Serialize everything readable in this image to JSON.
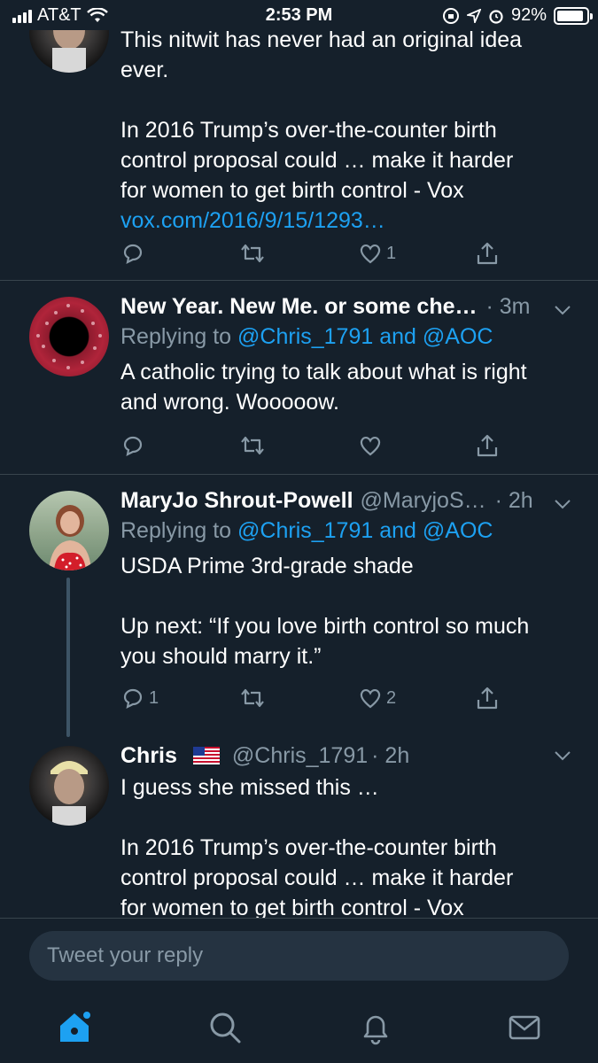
{
  "status_bar": {
    "carrier": "AT&T",
    "time": "2:53 PM",
    "battery": "92%",
    "battery_level": 0.92
  },
  "tweets": [
    {
      "body_lines": [
        "This nitwit has never had an original idea",
        "ever."
      ],
      "body2_lines": [
        "In 2016 Trump’s over-the-counter birth",
        "control proposal could … make it harder",
        "for women to get birth control - Vox"
      ],
      "link": "vox.com/2016/9/15/1293…",
      "counts": {
        "reply": "",
        "retweet": "",
        "like": "1"
      }
    },
    {
      "name": "New Year. New Me. or some che…",
      "time": "· 3m",
      "replying_prefix": "Replying to ",
      "replying_user1": "@Chris_1791",
      "replying_and": " and ",
      "replying_user2": "@AOC",
      "body_lines": [
        "A catholic trying to talk about what is right",
        "and wrong. Wooooow."
      ],
      "counts": {
        "reply": "",
        "retweet": "",
        "like": ""
      }
    },
    {
      "name": "MaryJo Shrout-Powell",
      "handle": "@MaryjoS…",
      "time": "· 2h",
      "replying_prefix": "Replying to ",
      "replying_user1": "@Chris_1791",
      "replying_and": " and ",
      "replying_user2": "@AOC",
      "body_lines": [
        "USDA Prime 3rd-grade shade"
      ],
      "body2_lines": [
        "Up next: “If you love birth control so much",
        "you should marry it.”"
      ],
      "counts": {
        "reply": "1",
        "retweet": "",
        "like": "2"
      }
    },
    {
      "name": "Chris",
      "flag": "us-flag-emoji",
      "handle": "@Chris_1791",
      "time": "· 2h",
      "body_lines": [
        "I guess she missed this …"
      ],
      "body2_lines": [
        "In 2016 Trump’s over-the-counter birth",
        "control proposal could … make it harder",
        "for women to get birth control - Vox"
      ]
    }
  ],
  "reply_bar": {
    "placeholder": "Tweet your reply"
  },
  "tab_bar": {
    "tabs": [
      "home-icon",
      "search-icon",
      "notifications-icon",
      "messages-icon"
    ],
    "active_color": "#1da1f2"
  },
  "colors": {
    "background": "#15202b",
    "accent": "#1da1f2",
    "secondary_text": "#8899a6",
    "divider": "#38444d"
  }
}
